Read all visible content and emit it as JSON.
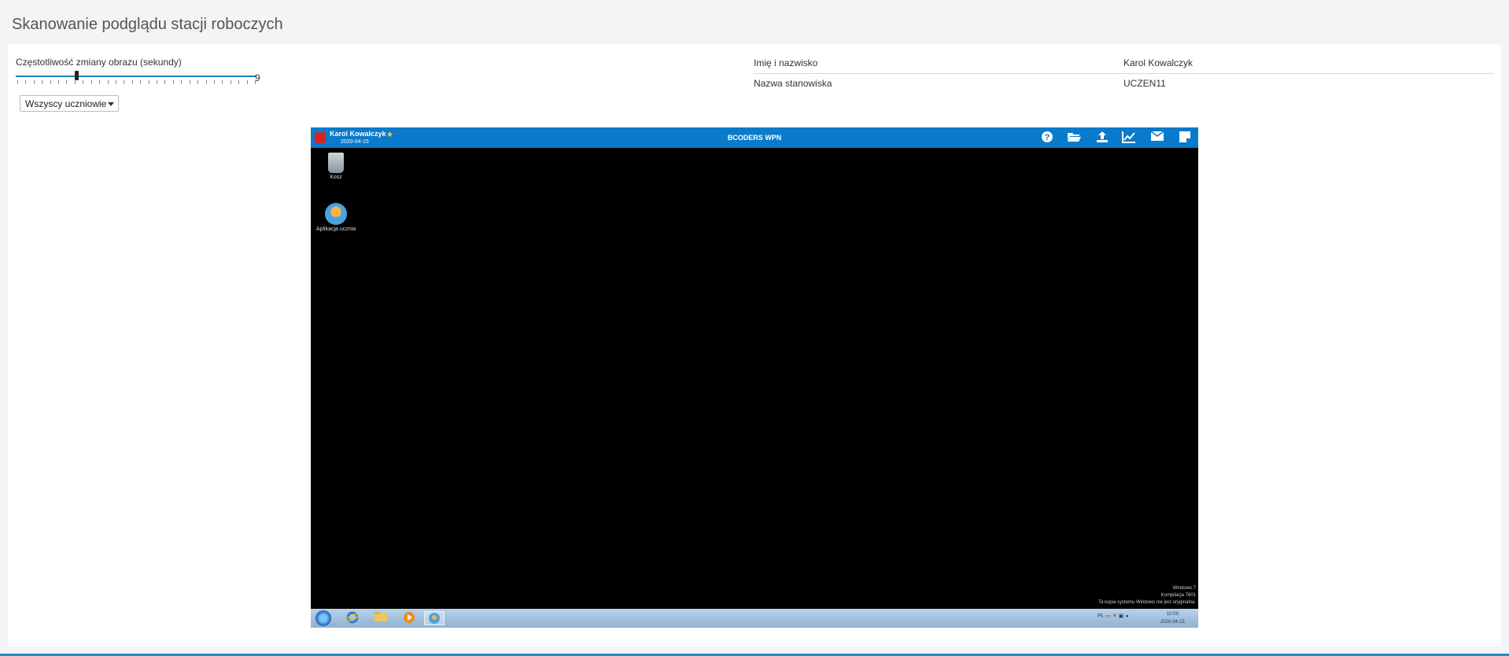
{
  "page": {
    "title": "Skanowanie podglądu stacji roboczych"
  },
  "slider": {
    "label": "Częstotliwość zmiany obrazu (sekundy)",
    "value": "9",
    "value_fraction": 0.25
  },
  "filter": {
    "selected": "Wszyscy uczniowie"
  },
  "info": {
    "rows": [
      {
        "label": "Imię i nazwisko",
        "value": "Karol Kowalczyk"
      },
      {
        "label": "Nazwa stanowiska",
        "value": "UCZEN11"
      }
    ]
  },
  "remote": {
    "app_bar": {
      "user": "Karol Kowalczyk",
      "date": "2020-04-15",
      "title": "BCODERS WPN"
    },
    "desktop_icons": [
      {
        "label": "Kosz",
        "icon": "trash-icon"
      },
      {
        "label": "Aplikacja ucznia",
        "icon": "student-app-icon"
      }
    ],
    "watermark": {
      "line1": "Windows 7",
      "line2": "Kompilacja 7601",
      "line3": "Ta kopia systemu Windows nie jest oryginalna."
    },
    "taskbar": {
      "lang": "PL",
      "time": "10:09",
      "date": "2020-04-15"
    }
  },
  "colors": {
    "accent": "#0a7acb",
    "slider": "#1a7fc4",
    "bottom_bar": "#1a8fc9"
  }
}
